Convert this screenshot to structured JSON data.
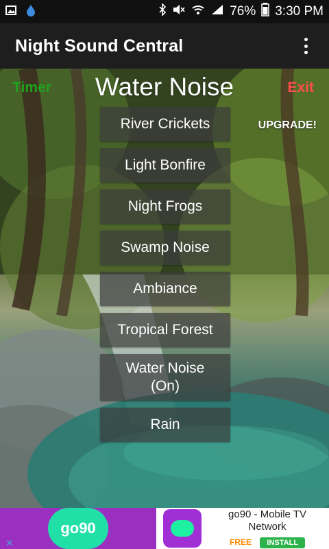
{
  "status_bar": {
    "battery": "76%",
    "time": "3:30 PM",
    "icons": [
      "image-icon",
      "water-drop-icon",
      "bluetooth-icon",
      "mute-icon",
      "wifi-icon",
      "signal-icon",
      "battery-icon"
    ]
  },
  "app_bar": {
    "title": "Night Sound Central",
    "menu_icon": "overflow-menu-icon"
  },
  "main": {
    "timer_label": "Timer",
    "current_sound_title": "Water Noise",
    "exit_label": "Exit",
    "upgrade_label": "UPGRADE!",
    "sounds": [
      {
        "label": "River Crickets"
      },
      {
        "label": "Light Bonfire"
      },
      {
        "label": "Night Frogs"
      },
      {
        "label": "Swamp Noise"
      },
      {
        "label": "Ambiance"
      },
      {
        "label": "Tropical Forest"
      },
      {
        "label": "Water Noise\n(On)",
        "active": true
      },
      {
        "label": "Rain"
      }
    ]
  },
  "ad": {
    "brand": "go90",
    "title_line1": "go90 - Mobile TV",
    "title_line2": "Network",
    "price": "FREE",
    "cta": "INSTALL",
    "close_icon": "close-icon"
  }
}
